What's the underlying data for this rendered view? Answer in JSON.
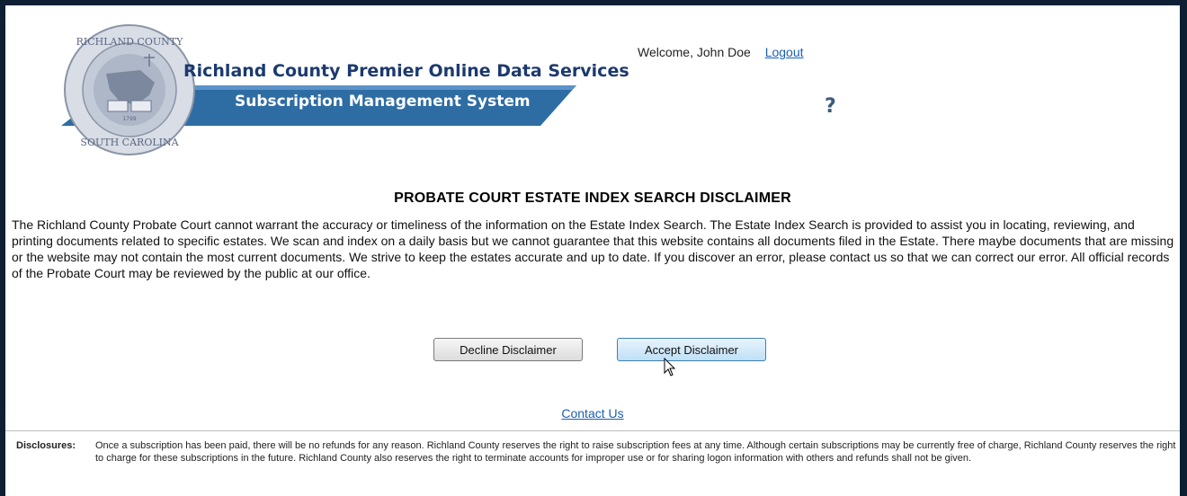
{
  "header": {
    "title": "Richland County Premier Online Data Services",
    "subtitle": "Subscription Management System",
    "seal_text_top": "RICHLAND COUNTY",
    "seal_text_bottom": "SOUTH CAROLINA",
    "seal_year": "1799",
    "welcome_text": "Welcome, John Doe",
    "logout_label": "Logout",
    "help_glyph": "?"
  },
  "disclaimer": {
    "title": "PROBATE COURT ESTATE INDEX SEARCH DISCLAIMER",
    "body": "The Richland County Probate Court cannot warrant the accuracy or timeliness of the information on the Estate Index Search. The Estate Index Search is provided to assist you in locating, reviewing, and printing documents related to specific estates. We scan and index on a daily basis but we cannot guarantee that this website contains all documents filed in the Estate. There maybe documents that are missing or the website may not contain the most current documents. We strive to keep the estates accurate and up to date. If you discover an error, please contact us so that we can correct our error. All official records of the Probate Court may be reviewed by the public at our office.",
    "decline_label": "Decline Disclaimer",
    "accept_label": "Accept Disclaimer"
  },
  "contact_label": "Contact Us",
  "footer": {
    "label": "Disclosures:",
    "text": "Once a subscription has been paid, there will be no refunds for any reason. Richland County reserves the right to raise subscription fees at any time. Although certain subscriptions may be currently free of charge, Richland County reserves the right to charge for these subscriptions in the future. Richland County also reserves the right to terminate accounts for improper use or for sharing logon information with others and refunds shall not be given."
  },
  "colors": {
    "banner_blue": "#2e6da4",
    "title_blue": "#1c3a6e",
    "link_blue": "#1a5fb4",
    "frame": "#0e1f33"
  },
  "icons": {
    "seal": "county-seal-icon",
    "help": "help-icon",
    "cursor": "mouse-pointer-icon"
  }
}
